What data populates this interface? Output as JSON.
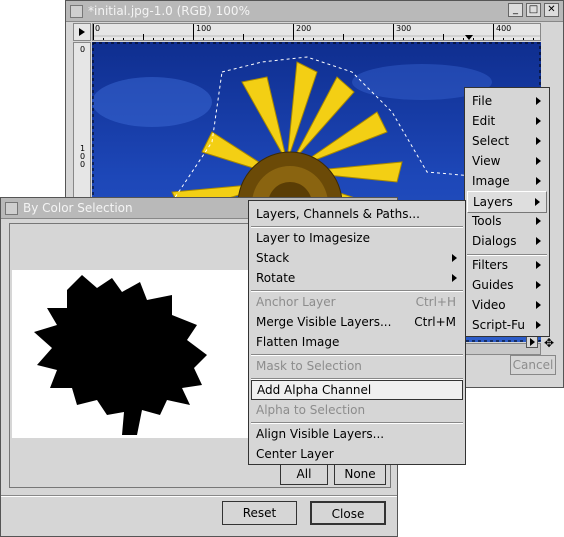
{
  "image_window": {
    "title": "*initial.jpg-1.0 (RGB) 100%",
    "ruler_ticks": [
      "0",
      "100",
      "200",
      "300",
      "400"
    ],
    "vruler_ticks": [
      "0",
      "100"
    ]
  },
  "image_menu": {
    "items": [
      {
        "label": "File"
      },
      {
        "label": "Edit"
      },
      {
        "label": "Select"
      },
      {
        "label": "View"
      },
      {
        "label": "Image"
      },
      {
        "label": "Layers"
      },
      {
        "label": "Tools"
      },
      {
        "label": "Dialogs"
      },
      {
        "label": "Filters"
      },
      {
        "label": "Guides"
      },
      {
        "label": "Video"
      },
      {
        "label": "Script-Fu"
      }
    ]
  },
  "layers_submenu": {
    "items": [
      {
        "label": "Layers, Channels & Paths..."
      },
      {
        "label": "Layer to Imagesize"
      },
      {
        "label": "Stack"
      },
      {
        "label": "Rotate"
      },
      {
        "label": "Anchor Layer",
        "shortcut": "Ctrl+H"
      },
      {
        "label": "Merge Visible Layers...",
        "shortcut": "Ctrl+M"
      },
      {
        "label": "Flatten Image"
      },
      {
        "label": "Mask to Selection"
      },
      {
        "label": "Add Alpha Channel"
      },
      {
        "label": "Alpha to Selection"
      },
      {
        "label": "Align Visible Layers..."
      },
      {
        "label": "Center Layer"
      }
    ]
  },
  "by_color_dialog": {
    "title": "By Color Selection",
    "all_label": "All",
    "none_label": "None",
    "reset_label": "Reset",
    "close_label": "Close"
  },
  "behind_dialog": {
    "cancel_label": "Cancel"
  }
}
